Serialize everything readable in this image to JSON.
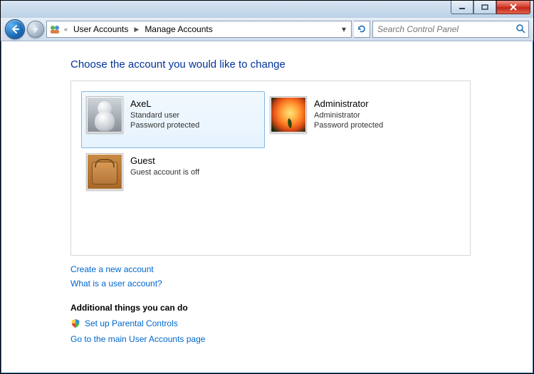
{
  "breadcrumb": {
    "prefix_glyph": "«",
    "items": [
      "User Accounts",
      "Manage Accounts"
    ]
  },
  "search": {
    "placeholder": "Search Control Panel"
  },
  "heading": "Choose the account you would like to change",
  "accounts": [
    {
      "name": "AxeL",
      "type": "Standard user",
      "status": "Password protected",
      "selected": true,
      "avatar": "axel"
    },
    {
      "name": "Administrator",
      "type": "Administrator",
      "status": "Password protected",
      "selected": false,
      "avatar": "admin"
    },
    {
      "name": "Guest",
      "type": "Guest account is off",
      "status": "",
      "selected": false,
      "avatar": "guest"
    }
  ],
  "links": {
    "create": "Create a new account",
    "what_is": "What is a user account?"
  },
  "additional": {
    "header": "Additional things you can do",
    "parental": "Set up Parental Controls",
    "main_page": "Go to the main User Accounts page"
  }
}
